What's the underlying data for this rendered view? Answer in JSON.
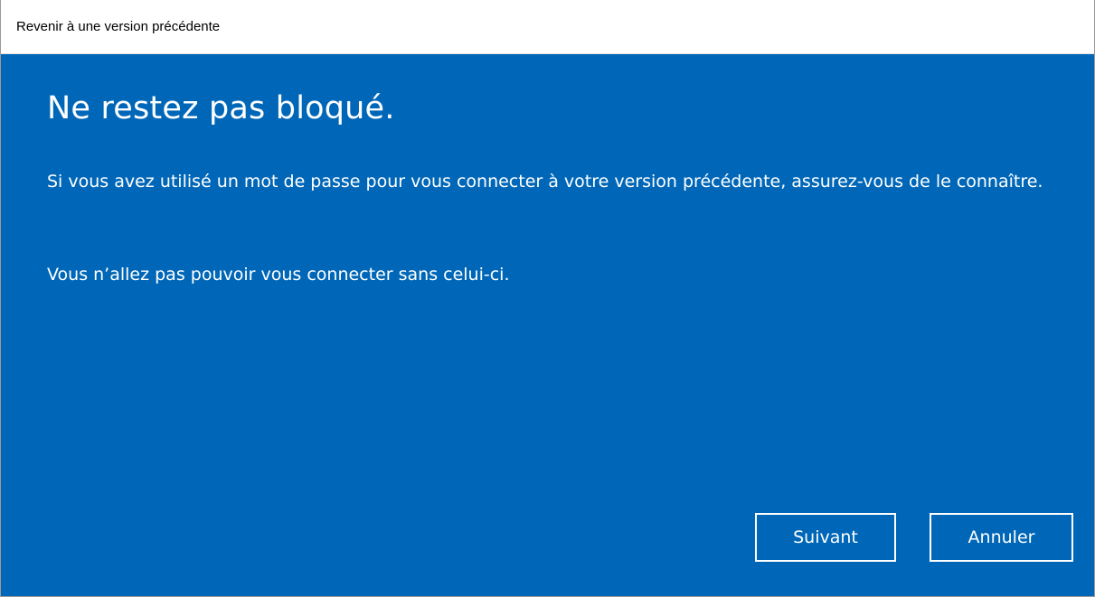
{
  "window": {
    "title": "Revenir à une version précédente"
  },
  "main": {
    "heading": "Ne restez pas bloqué.",
    "paragraph_1": "Si vous avez utilisé un mot de passe pour vous connecter à votre version précédente, assurez-vous de le connaître.",
    "paragraph_2": "Vous n’allez pas pouvoir vous connecter sans celui-ci."
  },
  "buttons": {
    "next_label": "Suivant",
    "cancel_label": "Annuler"
  },
  "colors": {
    "background": "#0067b8",
    "text": "#ffffff"
  }
}
